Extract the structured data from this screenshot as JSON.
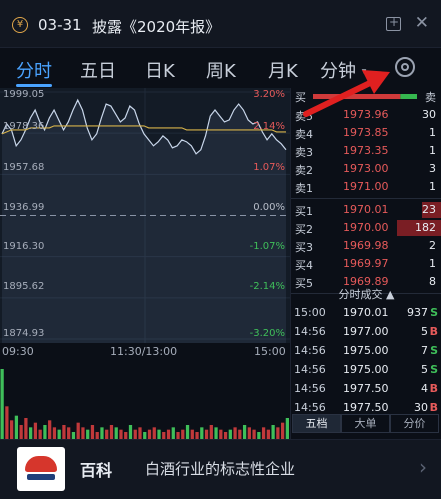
{
  "notice": {
    "date": "03-31",
    "title": "披露《2020年报》",
    "yen_symbol": "¥",
    "close_symbol": "✕"
  },
  "tabs": [
    {
      "label": "分时",
      "active": true
    },
    {
      "label": "五日"
    },
    {
      "label": "日K"
    },
    {
      "label": "周K"
    },
    {
      "label": "月K"
    },
    {
      "label": "分钟",
      "caret": "▾"
    }
  ],
  "chart": {
    "price_labels": [
      "1999.05",
      "1978.36",
      "1957.68",
      "1936.99",
      "1916.30",
      "1895.62",
      "1874.93"
    ],
    "pct_labels": [
      "3.20%",
      "2.14%",
      "1.07%",
      "0.00%",
      "-1.07%",
      "-2.14%",
      "-3.20%"
    ],
    "time_labels": [
      "09:30",
      "11:30/13:00",
      "15:00"
    ],
    "colors": {
      "up": "#e65a5a",
      "flat": "#b8bec9",
      "down": "#3fbf5a",
      "price_line": "#c8d6ea",
      "avg_line": "#d7b34a"
    }
  },
  "chart_data": {
    "type": "line",
    "series": [
      {
        "name": "价格",
        "values": [
          1978,
          1983,
          1980,
          1972,
          1975,
          1980,
          1986,
          1990,
          1984,
          1980,
          1986,
          1990,
          1985,
          1980,
          1984,
          1990,
          1995,
          1990,
          1981,
          1975,
          1978,
          1986,
          1993,
          1992,
          1988,
          1984,
          1986,
          1992,
          1990,
          1983,
          1978,
          1975,
          1972,
          1974,
          1977,
          1975,
          1971,
          1972,
          1975,
          1974,
          1972,
          1968,
          1970,
          1977,
          1987,
          1990,
          1987,
          1984,
          1985,
          1990,
          1993,
          1990,
          1985,
          1983,
          1984,
          1979,
          1975,
          1978,
          1975,
          1973,
          1970
        ]
      },
      {
        "name": "均价",
        "values": [
          1978,
          1979,
          1980,
          1980,
          1980,
          1980,
          1981,
          1981,
          1981,
          1981,
          1981,
          1982,
          1982,
          1982,
          1982,
          1982,
          1982,
          1982,
          1982,
          1982,
          1982,
          1982,
          1982,
          1982,
          1982,
          1982,
          1982,
          1982,
          1982,
          1982,
          1982,
          1981,
          1981,
          1981,
          1981,
          1981,
          1981,
          1981,
          1981,
          1980,
          1980,
          1980,
          1980,
          1980,
          1980,
          1980,
          1980,
          1980,
          1980,
          1980,
          1980,
          1980,
          1980,
          1980,
          1980,
          1980,
          1980,
          1980,
          1979,
          1979,
          1979
        ]
      }
    ],
    "ylim": [
      1874.93,
      1999.05
    ],
    "reference": 1936.99,
    "volume": [
      30,
      14,
      8,
      10,
      6,
      9,
      5,
      7,
      4,
      6,
      8,
      5,
      4,
      6,
      5,
      3,
      7,
      5,
      4,
      6,
      3,
      5,
      4,
      6,
      5,
      4,
      3,
      6,
      4,
      5,
      3,
      4,
      5,
      4,
      3,
      4,
      5,
      3,
      4,
      6,
      4,
      3,
      5,
      4,
      6,
      5,
      4,
      3,
      4,
      5,
      4,
      6,
      5,
      4,
      3,
      5,
      4,
      6,
      5,
      7,
      9
    ]
  },
  "book": {
    "buy_label": "买",
    "sell_label": "卖",
    "ratio_buy": 0.84,
    "asks": [
      {
        "label": "卖5",
        "price": "1973.96",
        "qty": "30"
      },
      {
        "label": "卖4",
        "price": "1973.85",
        "qty": "1"
      },
      {
        "label": "卖3",
        "price": "1973.35",
        "qty": "1"
      },
      {
        "label": "卖2",
        "price": "1973.00",
        "qty": "3"
      },
      {
        "label": "卖1",
        "price": "1971.00",
        "qty": "1"
      }
    ],
    "bids": [
      {
        "label": "买1",
        "price": "1970.01",
        "qty": "23",
        "bar": 0.13
      },
      {
        "label": "买2",
        "price": "1970.00",
        "qty": "182",
        "bar": 0.3
      },
      {
        "label": "买3",
        "price": "1969.98",
        "qty": "2",
        "bar": 0
      },
      {
        "label": "买4",
        "price": "1969.97",
        "qty": "1",
        "bar": 0
      },
      {
        "label": "买5",
        "price": "1969.89",
        "qty": "8",
        "bar": 0
      }
    ],
    "trades_title": "分时成交 ▲",
    "trades": [
      {
        "time": "15:00",
        "price": "1970.01",
        "vol": "937",
        "side": "S",
        "side_color": "#3fbf5a"
      },
      {
        "time": "14:56",
        "price": "1977.00",
        "vol": "5",
        "side": "B",
        "side_color": "#e65a5a"
      },
      {
        "time": "14:56",
        "price": "1975.00",
        "vol": "7",
        "side": "S",
        "side_color": "#3fbf5a"
      },
      {
        "time": "14:56",
        "price": "1975.00",
        "vol": "5",
        "side": "S",
        "side_color": "#3fbf5a"
      },
      {
        "time": "14:56",
        "price": "1977.50",
        "vol": "4",
        "side": "B",
        "side_color": "#e65a5a"
      },
      {
        "time": "14:56",
        "price": "1977.50",
        "vol": "30",
        "side": "B",
        "side_color": "#e65a5a"
      }
    ],
    "subtabs": [
      "五档",
      "大单",
      "分价"
    ]
  },
  "banner": {
    "name": "百科",
    "desc": "白酒行业的标志性企业",
    "chevron": "›"
  }
}
